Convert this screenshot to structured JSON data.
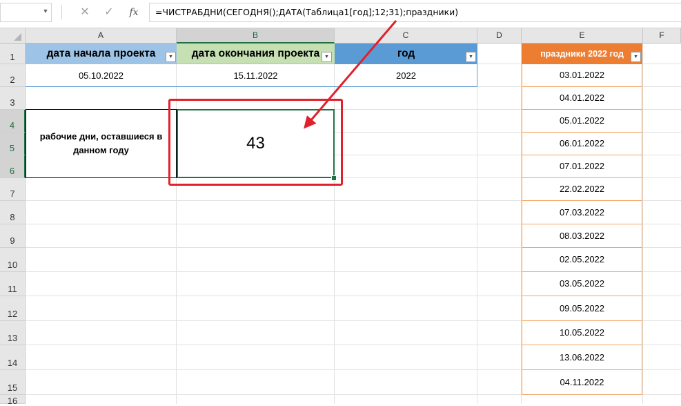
{
  "formula_bar": {
    "cancel_icon": "✕",
    "enter_icon": "✓",
    "fx_label": "fx",
    "formula": "=ЧИСТРАБДНИ(СЕГОДНЯ();ДАТА(Таблица1[год];12;31);праздники)"
  },
  "columns": [
    "A",
    "B",
    "C",
    "D",
    "E",
    "F"
  ],
  "rows": [
    "1",
    "2",
    "3",
    "4",
    "5",
    "6",
    "7",
    "8",
    "9",
    "10",
    "11",
    "12",
    "13",
    "14",
    "15",
    "16"
  ],
  "table1": {
    "headers": [
      "дата начала проекта",
      "дата окончания проекта",
      "год"
    ],
    "values": [
      "05.10.2022",
      "15.11.2022",
      "2022"
    ],
    "header_colors": [
      "#9dc3e6",
      "#c6e0b4",
      "#5b9bd5"
    ]
  },
  "label_box": {
    "text": "рабочие дни, оставшиеся в данном году"
  },
  "result": {
    "value": "43"
  },
  "holidays": {
    "header": "праздники 2022 год",
    "header_color": "#ed7d31",
    "dates": [
      "03.01.2022",
      "04.01.2022",
      "05.01.2022",
      "06.01.2022",
      "07.01.2022",
      "22.02.2022",
      "07.03.2022",
      "08.03.2022",
      "02.05.2022",
      "03.05.2022",
      "09.05.2022",
      "10.05.2022",
      "13.06.2022",
      "04.11.2022"
    ]
  },
  "annotation": {
    "color": "#e0202a"
  }
}
